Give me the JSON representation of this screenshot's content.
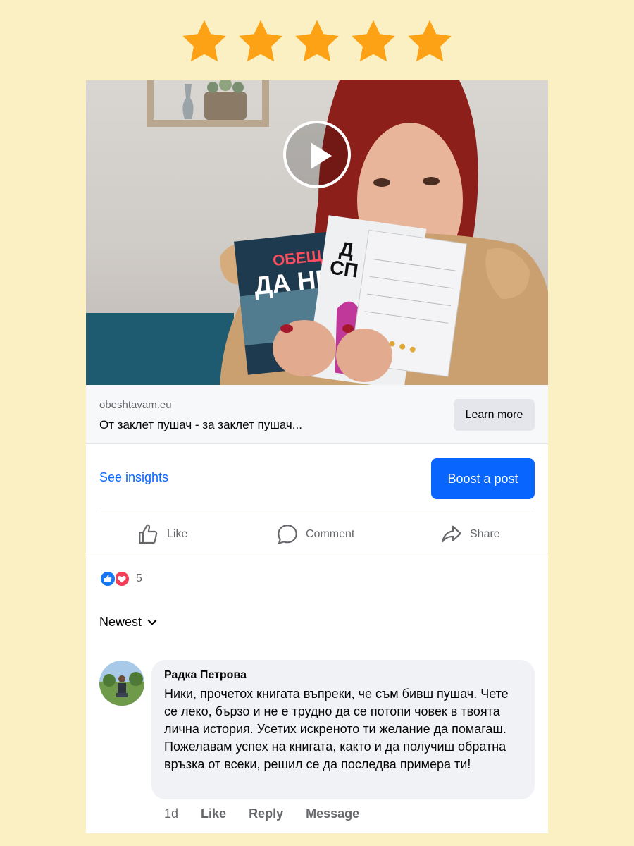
{
  "rating": {
    "stars": 5,
    "color": "#fda214"
  },
  "video": {
    "play_icon": "play-icon",
    "book_left_title_top": "ОБЕЩ",
    "book_left_title_mid": "ДА НЕ",
    "book_mid_title_top": "Д",
    "book_mid_title_mid": "СП"
  },
  "link_preview": {
    "domain": "obeshtavam.eu",
    "title": "От заклет пушач - за заклет пушач...",
    "cta_label": "Learn more"
  },
  "insights": {
    "see_insights_label": "See insights",
    "boost_label": "Boost a post",
    "boost_color": "#0866ff"
  },
  "actions": {
    "like_label": "Like",
    "comment_label": "Comment",
    "share_label": "Share"
  },
  "reactions": {
    "icons": [
      "like-reaction-icon",
      "love-reaction-icon"
    ],
    "count": "5"
  },
  "sort": {
    "label": "Newest"
  },
  "comment": {
    "author": "Радка Петрова",
    "text": "Ники, прочетох книгата въпреки, че съм бивш пушач. Чете се леко, бързо и не е трудно да се потопи човек в твоята лична история. Усетих искреното ти желание да помагаш. Пожелавам успех на книгата, както и да получиш обратна връзка от всеки, решил се да последва примера ти!",
    "time": "1d",
    "like_label": "Like",
    "reply_label": "Reply",
    "message_label": "Message"
  }
}
